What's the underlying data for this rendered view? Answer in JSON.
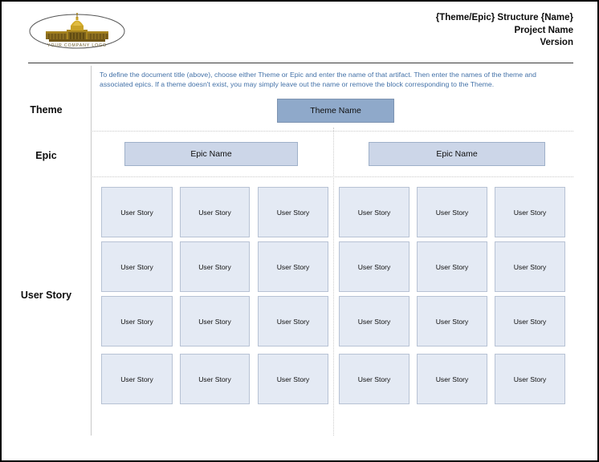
{
  "document": {
    "title_line1": "{Theme/Epic} Structure {Name}",
    "title_line2": "Project Name",
    "title_line3": "Version"
  },
  "logo": {
    "caption": "YOUR COMPANY LOGO",
    "icon": "capitol-building-icon",
    "colors": {
      "dome": "#c9a227",
      "building": "#8a6d1f",
      "outline": "#555555"
    }
  },
  "instruction": {
    "text": "To define the document title (above), choose either Theme or Epic and enter the name of that artifact. Then enter the names of the theme and associated epics.  If a theme doesn't exist, you may simply leave out the name or remove the block corresponding to the Theme.",
    "color": "#4472a8"
  },
  "rows": {
    "theme_label": "Theme",
    "epic_label": "Epic",
    "story_label": "User Story"
  },
  "theme": {
    "label": "Theme Name",
    "fill": "#8fa9ca",
    "border": "#7d93b1"
  },
  "epics": [
    {
      "label": "Epic Name"
    },
    {
      "label": "Epic Name"
    }
  ],
  "epic_style": {
    "fill": "#ccd6e8",
    "border": "#9fb0c9"
  },
  "story_style": {
    "fill": "#e4eaf4",
    "border": "#b7c2d4"
  },
  "stories": {
    "label": "User Story",
    "rows": 4,
    "columns": 6,
    "groups": [
      {
        "epic_index": 0,
        "cells": [
          [
            "User Story",
            "User Story",
            "User Story"
          ],
          [
            "User Story",
            "User Story",
            "User Story"
          ],
          [
            "User Story",
            "User Story",
            "User Story"
          ],
          [
            "User Story",
            "User Story",
            "User Story"
          ]
        ]
      },
      {
        "epic_index": 1,
        "cells": [
          [
            "User Story",
            "User Story",
            "User Story"
          ],
          [
            "User Story",
            "User Story",
            "User Story"
          ],
          [
            "User Story",
            "User Story",
            "User Story"
          ],
          [
            "User Story",
            "User Story",
            "User Story"
          ]
        ]
      }
    ]
  }
}
